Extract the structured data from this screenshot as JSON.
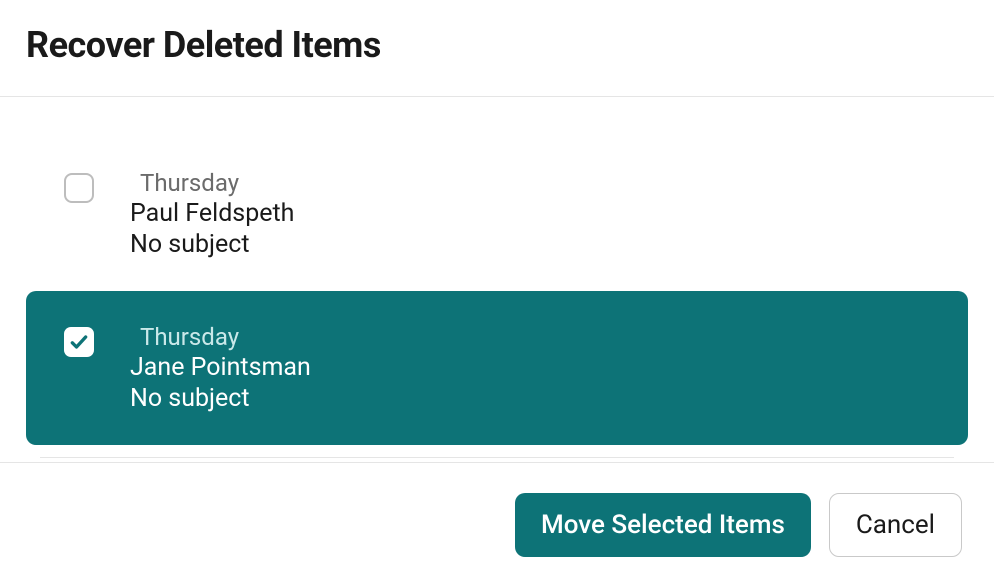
{
  "dialog": {
    "title": "Recover Deleted Items"
  },
  "items": [
    {
      "date": "Thursday",
      "sender": "Paul Feldspeth",
      "subject": "No subject",
      "selected": false
    },
    {
      "date": "Thursday",
      "sender": "Jane Pointsman",
      "subject": "No subject",
      "selected": true
    }
  ],
  "footer": {
    "move_label": "Move Selected Items",
    "cancel_label": "Cancel"
  }
}
